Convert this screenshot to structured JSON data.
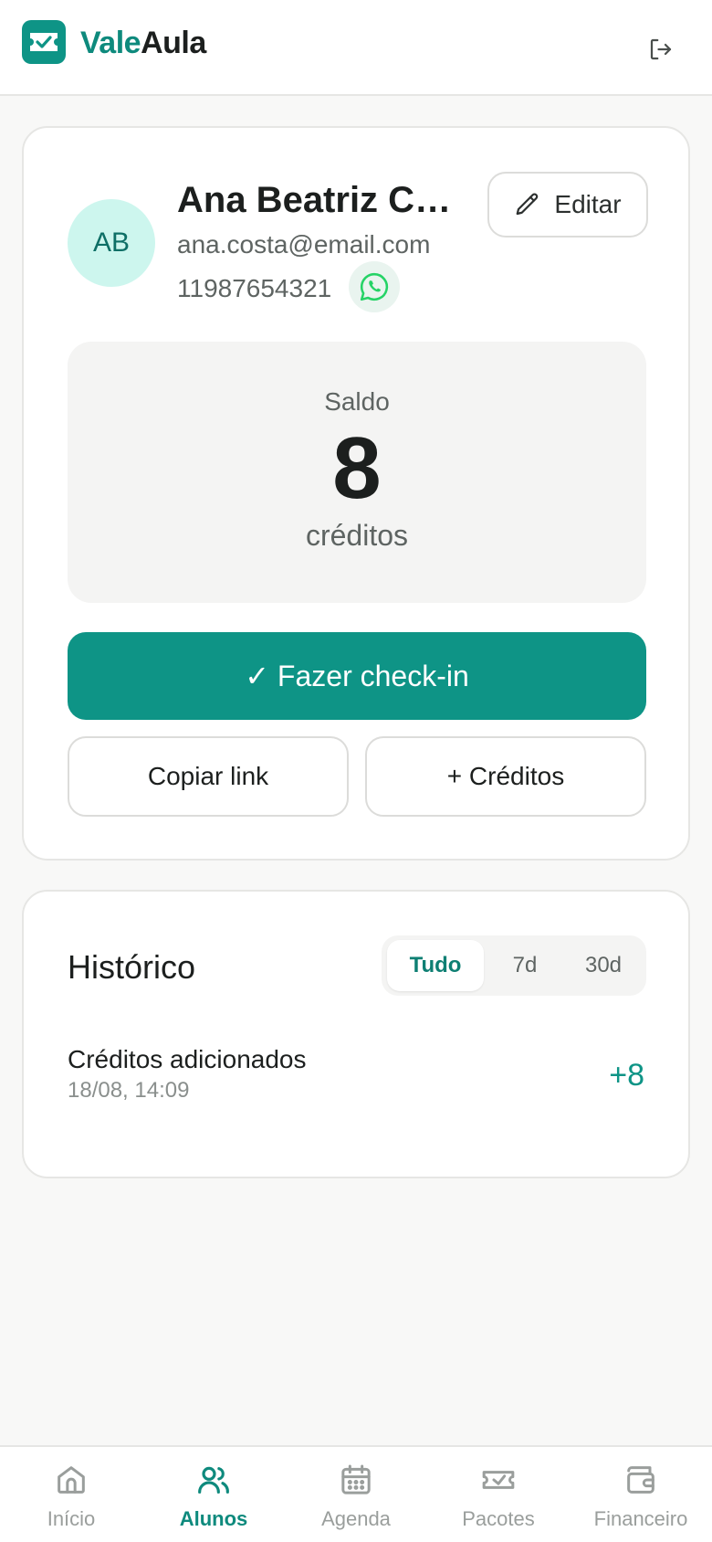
{
  "header": {
    "brand_part1": "Vale",
    "brand_part2": "Aula",
    "logo_icon": "ticket-check-icon",
    "logout_icon": "logout-icon"
  },
  "profile": {
    "initials": "AB",
    "name": "Ana Beatriz Co...",
    "email": "ana.costa@email.com",
    "phone": "11987654321",
    "whatsapp_icon": "whatsapp-icon",
    "edit_label": "Editar",
    "balance_label": "Saldo",
    "balance_value": "8",
    "balance_unit": "créditos",
    "checkin_label": "✓ Fazer check-in",
    "copy_link_label": "Copiar link",
    "add_credits_label": "+ Créditos"
  },
  "history": {
    "title": "Histórico",
    "filters": [
      "Tudo",
      "7d",
      "30d"
    ],
    "active_filter": "Tudo",
    "entries": [
      {
        "title": "Créditos adicionados",
        "date": "18/08, 14:09",
        "amount": "+8"
      }
    ]
  },
  "nav": {
    "items": [
      {
        "label": "Início",
        "icon": "home-icon"
      },
      {
        "label": "Alunos",
        "icon": "users-icon"
      },
      {
        "label": "Agenda",
        "icon": "calendar-icon"
      },
      {
        "label": "Pacotes",
        "icon": "ticket-icon"
      },
      {
        "label": "Financeiro",
        "icon": "wallet-icon"
      }
    ],
    "active": "Alunos"
  },
  "colors": {
    "accent": "#0e9486",
    "avatar_bg": "#cdf6ee",
    "whatsapp": "#25d366"
  }
}
